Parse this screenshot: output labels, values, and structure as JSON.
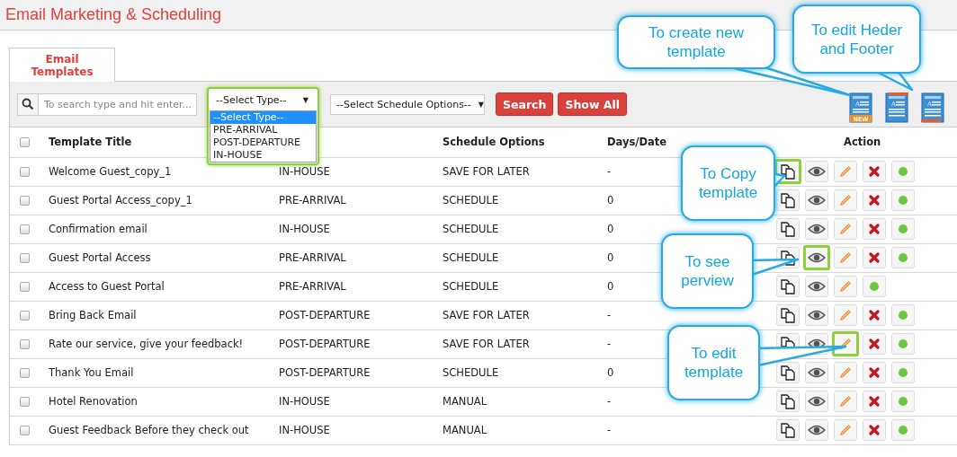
{
  "header": {
    "title": "Email Marketing & Scheduling"
  },
  "tabs": [
    {
      "label": "Email Templates",
      "selected": true
    }
  ],
  "toolbar": {
    "search": {
      "placeholder": "To search type and hit enter..."
    },
    "type_select": {
      "value": "--Select Type--",
      "caret": "▼",
      "expanded": true,
      "highlighted": true,
      "options": [
        {
          "label": "--Select Type--",
          "selected": true
        },
        {
          "label": "PRE-ARRIVAL",
          "selected": false
        },
        {
          "label": "POST-DEPARTURE",
          "selected": false
        },
        {
          "label": "IN-HOUSE",
          "selected": false
        }
      ]
    },
    "schedule_select": {
      "value": "--Select Schedule Options--",
      "caret": "▼"
    },
    "buttons": [
      "Search",
      "Show All"
    ],
    "template_icons": [
      {
        "kind": "new",
        "letter": "A",
        "badge": "NEW"
      },
      {
        "kind": "header",
        "letter": "A"
      },
      {
        "kind": "footer",
        "letter": "A"
      }
    ]
  },
  "table": {
    "select_all_checked": false,
    "columns": [
      {
        "label": "Template Title"
      },
      {
        "label": "Schedule Options"
      },
      {
        "label": "Days/Date"
      },
      {
        "label": "Action"
      }
    ],
    "rows": [
      {
        "checked": false,
        "title": "Welcome Guest_copy_1",
        "type": "IN-HOUSE",
        "schedule": "SAVE FOR LATER",
        "days": "-",
        "actions": [
          {
            "kind": "copy",
            "highlighted": true
          },
          {
            "kind": "preview",
            "highlighted": false
          },
          {
            "kind": "edit",
            "highlighted": false
          },
          {
            "kind": "delete",
            "highlighted": false
          },
          {
            "kind": "activate",
            "highlighted": false
          }
        ]
      },
      {
        "checked": false,
        "title": "Guest Portal Access_copy_1",
        "type": "PRE-ARRIVAL",
        "schedule": "SCHEDULE",
        "days": "0",
        "actions": [
          {
            "kind": "copy",
            "highlighted": false
          },
          {
            "kind": "preview",
            "highlighted": false
          },
          {
            "kind": "edit",
            "highlighted": false
          },
          {
            "kind": "delete",
            "highlighted": false
          },
          {
            "kind": "activate",
            "highlighted": false
          }
        ]
      },
      {
        "checked": false,
        "title": "Confirmation email",
        "type": "IN-HOUSE",
        "schedule": "SCHEDULE",
        "days": "0",
        "actions": [
          {
            "kind": "copy",
            "highlighted": false
          },
          {
            "kind": "preview",
            "highlighted": false
          },
          {
            "kind": "edit",
            "highlighted": false
          },
          {
            "kind": "delete",
            "highlighted": false
          },
          {
            "kind": "activate",
            "highlighted": false
          }
        ]
      },
      {
        "checked": false,
        "title": "Guest Portal Access",
        "type": "PRE-ARRIVAL",
        "schedule": "SCHEDULE",
        "days": "0",
        "actions": [
          {
            "kind": "copy",
            "highlighted": false
          },
          {
            "kind": "preview",
            "highlighted": true
          },
          {
            "kind": "edit",
            "highlighted": false
          },
          {
            "kind": "delete",
            "highlighted": false
          },
          {
            "kind": "activate",
            "highlighted": false
          }
        ]
      },
      {
        "checked": false,
        "title": "Access to Guest Portal",
        "type": "PRE-ARRIVAL",
        "schedule": "SCHEDULE",
        "days": "0",
        "actions": [
          {
            "kind": "copy",
            "highlighted": false
          },
          {
            "kind": "preview",
            "highlighted": false
          },
          {
            "kind": "edit",
            "highlighted": false
          },
          {
            "kind": "activate",
            "highlighted": false
          }
        ]
      },
      {
        "checked": false,
        "title": "Bring Back Email",
        "type": "POST-DEPARTURE",
        "schedule": "SAVE FOR LATER",
        "days": "-",
        "actions": [
          {
            "kind": "copy",
            "highlighted": false
          },
          {
            "kind": "preview",
            "highlighted": false
          },
          {
            "kind": "edit",
            "highlighted": false
          },
          {
            "kind": "delete",
            "highlighted": false
          },
          {
            "kind": "activate",
            "highlighted": false
          }
        ]
      },
      {
        "checked": false,
        "title": "Rate our service, give your feedback!",
        "type": "POST-DEPARTURE",
        "schedule": "SAVE FOR LATER",
        "days": "-",
        "actions": [
          {
            "kind": "copy",
            "highlighted": false
          },
          {
            "kind": "preview",
            "highlighted": false
          },
          {
            "kind": "edit",
            "highlighted": true
          },
          {
            "kind": "delete",
            "highlighted": false
          },
          {
            "kind": "activate",
            "highlighted": false
          }
        ]
      },
      {
        "checked": false,
        "title": "Thank You Email",
        "type": "POST-DEPARTURE",
        "schedule": "SCHEDULE",
        "days": "0",
        "actions": [
          {
            "kind": "copy",
            "highlighted": false
          },
          {
            "kind": "preview",
            "highlighted": false
          },
          {
            "kind": "edit",
            "highlighted": false
          },
          {
            "kind": "delete",
            "highlighted": false
          },
          {
            "kind": "activate",
            "highlighted": false
          }
        ]
      },
      {
        "checked": false,
        "title": "Hotel Renovation",
        "type": "IN-HOUSE",
        "schedule": "MANUAL",
        "days": "-",
        "actions": [
          {
            "kind": "copy",
            "highlighted": false
          },
          {
            "kind": "preview",
            "highlighted": false
          },
          {
            "kind": "edit",
            "highlighted": false
          },
          {
            "kind": "delete",
            "highlighted": false
          },
          {
            "kind": "activate",
            "highlighted": false
          }
        ]
      },
      {
        "checked": false,
        "title": "Guest Feedback Before they check out",
        "type": "IN-HOUSE",
        "schedule": "MANUAL",
        "days": "-",
        "actions": [
          {
            "kind": "copy",
            "highlighted": false
          },
          {
            "kind": "preview",
            "highlighted": false
          },
          {
            "kind": "edit",
            "highlighted": false
          },
          {
            "kind": "delete",
            "highlighted": false
          },
          {
            "kind": "activate",
            "highlighted": false
          }
        ]
      }
    ]
  },
  "callouts": [
    {
      "text": "To create new template"
    },
    {
      "text": "To edit Heder and Footer"
    },
    {
      "text": "To Copy template"
    },
    {
      "text": "To see perview"
    },
    {
      "text": "To edit template"
    }
  ]
}
